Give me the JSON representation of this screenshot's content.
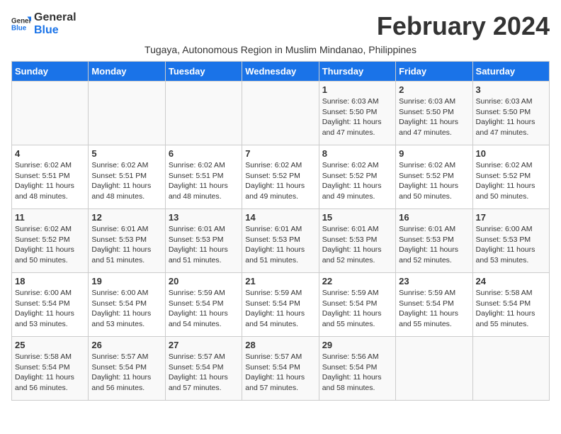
{
  "logo": {
    "line1": "General",
    "line2": "Blue"
  },
  "month_title": "February 2024",
  "subtitle": "Tugaya, Autonomous Region in Muslim Mindanao, Philippines",
  "days_of_week": [
    "Sunday",
    "Monday",
    "Tuesday",
    "Wednesday",
    "Thursday",
    "Friday",
    "Saturday"
  ],
  "weeks": [
    [
      {
        "day": "",
        "info": ""
      },
      {
        "day": "",
        "info": ""
      },
      {
        "day": "",
        "info": ""
      },
      {
        "day": "",
        "info": ""
      },
      {
        "day": "1",
        "info": "Sunrise: 6:03 AM\nSunset: 5:50 PM\nDaylight: 11 hours and 47 minutes."
      },
      {
        "day": "2",
        "info": "Sunrise: 6:03 AM\nSunset: 5:50 PM\nDaylight: 11 hours and 47 minutes."
      },
      {
        "day": "3",
        "info": "Sunrise: 6:03 AM\nSunset: 5:50 PM\nDaylight: 11 hours and 47 minutes."
      }
    ],
    [
      {
        "day": "4",
        "info": "Sunrise: 6:02 AM\nSunset: 5:51 PM\nDaylight: 11 hours and 48 minutes."
      },
      {
        "day": "5",
        "info": "Sunrise: 6:02 AM\nSunset: 5:51 PM\nDaylight: 11 hours and 48 minutes."
      },
      {
        "day": "6",
        "info": "Sunrise: 6:02 AM\nSunset: 5:51 PM\nDaylight: 11 hours and 48 minutes."
      },
      {
        "day": "7",
        "info": "Sunrise: 6:02 AM\nSunset: 5:52 PM\nDaylight: 11 hours and 49 minutes."
      },
      {
        "day": "8",
        "info": "Sunrise: 6:02 AM\nSunset: 5:52 PM\nDaylight: 11 hours and 49 minutes."
      },
      {
        "day": "9",
        "info": "Sunrise: 6:02 AM\nSunset: 5:52 PM\nDaylight: 11 hours and 50 minutes."
      },
      {
        "day": "10",
        "info": "Sunrise: 6:02 AM\nSunset: 5:52 PM\nDaylight: 11 hours and 50 minutes."
      }
    ],
    [
      {
        "day": "11",
        "info": "Sunrise: 6:02 AM\nSunset: 5:52 PM\nDaylight: 11 hours and 50 minutes."
      },
      {
        "day": "12",
        "info": "Sunrise: 6:01 AM\nSunset: 5:53 PM\nDaylight: 11 hours and 51 minutes."
      },
      {
        "day": "13",
        "info": "Sunrise: 6:01 AM\nSunset: 5:53 PM\nDaylight: 11 hours and 51 minutes."
      },
      {
        "day": "14",
        "info": "Sunrise: 6:01 AM\nSunset: 5:53 PM\nDaylight: 11 hours and 51 minutes."
      },
      {
        "day": "15",
        "info": "Sunrise: 6:01 AM\nSunset: 5:53 PM\nDaylight: 11 hours and 52 minutes."
      },
      {
        "day": "16",
        "info": "Sunrise: 6:01 AM\nSunset: 5:53 PM\nDaylight: 11 hours and 52 minutes."
      },
      {
        "day": "17",
        "info": "Sunrise: 6:00 AM\nSunset: 5:53 PM\nDaylight: 11 hours and 53 minutes."
      }
    ],
    [
      {
        "day": "18",
        "info": "Sunrise: 6:00 AM\nSunset: 5:54 PM\nDaylight: 11 hours and 53 minutes."
      },
      {
        "day": "19",
        "info": "Sunrise: 6:00 AM\nSunset: 5:54 PM\nDaylight: 11 hours and 53 minutes."
      },
      {
        "day": "20",
        "info": "Sunrise: 5:59 AM\nSunset: 5:54 PM\nDaylight: 11 hours and 54 minutes."
      },
      {
        "day": "21",
        "info": "Sunrise: 5:59 AM\nSunset: 5:54 PM\nDaylight: 11 hours and 54 minutes."
      },
      {
        "day": "22",
        "info": "Sunrise: 5:59 AM\nSunset: 5:54 PM\nDaylight: 11 hours and 55 minutes."
      },
      {
        "day": "23",
        "info": "Sunrise: 5:59 AM\nSunset: 5:54 PM\nDaylight: 11 hours and 55 minutes."
      },
      {
        "day": "24",
        "info": "Sunrise: 5:58 AM\nSunset: 5:54 PM\nDaylight: 11 hours and 55 minutes."
      }
    ],
    [
      {
        "day": "25",
        "info": "Sunrise: 5:58 AM\nSunset: 5:54 PM\nDaylight: 11 hours and 56 minutes."
      },
      {
        "day": "26",
        "info": "Sunrise: 5:57 AM\nSunset: 5:54 PM\nDaylight: 11 hours and 56 minutes."
      },
      {
        "day": "27",
        "info": "Sunrise: 5:57 AM\nSunset: 5:54 PM\nDaylight: 11 hours and 57 minutes."
      },
      {
        "day": "28",
        "info": "Sunrise: 5:57 AM\nSunset: 5:54 PM\nDaylight: 11 hours and 57 minutes."
      },
      {
        "day": "29",
        "info": "Sunrise: 5:56 AM\nSunset: 5:54 PM\nDaylight: 11 hours and 58 minutes."
      },
      {
        "day": "",
        "info": ""
      },
      {
        "day": "",
        "info": ""
      }
    ]
  ]
}
